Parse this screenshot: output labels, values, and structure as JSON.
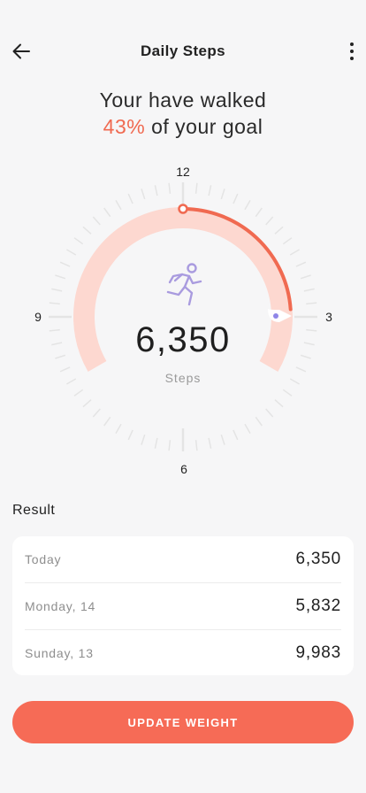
{
  "header": {
    "title": "Daily Steps",
    "back_icon": "arrow-left-icon",
    "menu_icon": "more-vertical-icon"
  },
  "headline": {
    "line1": "Your have walked",
    "percent": "43%",
    "line2_rest": " of your goal"
  },
  "gauge": {
    "progress_fraction": 0.43,
    "steps_value": "6,350",
    "steps_label": "Steps",
    "clock": {
      "top": "12",
      "right": "3",
      "bottom": "6",
      "left": "9"
    },
    "runner_icon": "runner-icon",
    "colors": {
      "track": "#fdd8d0",
      "progress": "#f06a51",
      "ticks": "#e4e4e4",
      "runner": "#a99bdf"
    }
  },
  "result": {
    "label": "Result",
    "rows": [
      {
        "label": "Today",
        "value": "6,350"
      },
      {
        "label": "Monday, 14",
        "value": "5,832"
      },
      {
        "label": "Sunday, 13",
        "value": "9,983"
      }
    ]
  },
  "action": {
    "update_label": "UPDATE WEIGHT",
    "color": "#f66b56"
  }
}
